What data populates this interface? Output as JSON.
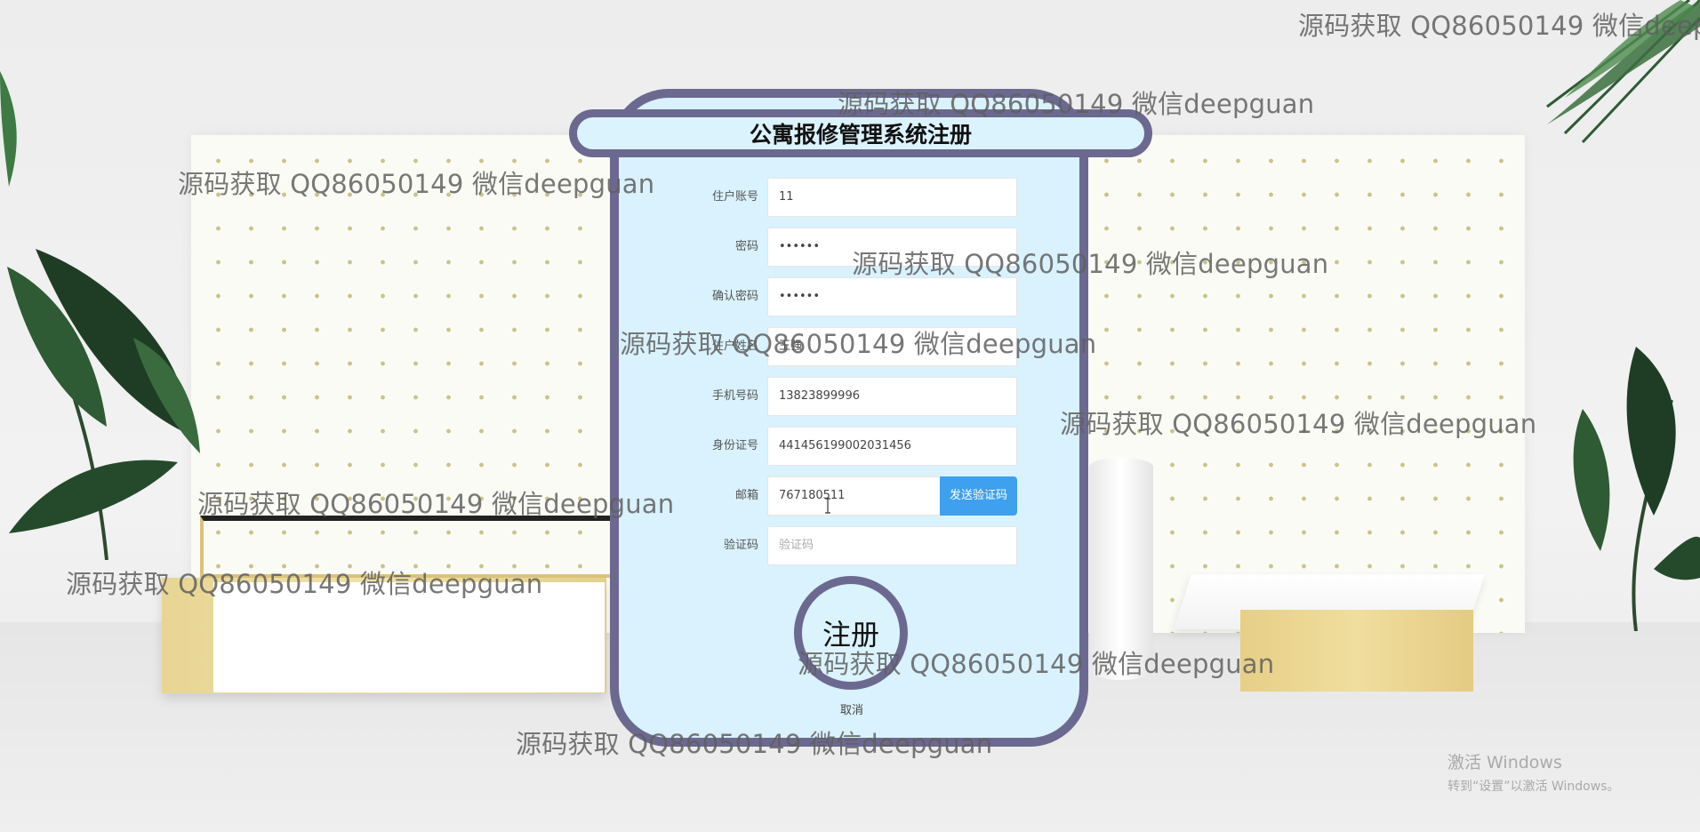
{
  "form": {
    "title": "公寓报修管理系统注册",
    "fields": [
      {
        "label": "住户账号",
        "value": "11"
      },
      {
        "label": "密码",
        "value": "••••••"
      },
      {
        "label": "确认密码",
        "value": "••••••"
      },
      {
        "label": "住户姓名",
        "value": "王强"
      },
      {
        "label": "手机号码",
        "value": "13823899996"
      },
      {
        "label": "身份证号",
        "value": "441456199002031456"
      },
      {
        "label": "邮箱",
        "value": "767180511"
      },
      {
        "label": "验证码",
        "placeholder": "验证码"
      }
    ],
    "send_code_label": "发送验证码",
    "register_label": "注册",
    "cancel_label": "取消"
  },
  "watermark_text": "源码获取 QQ86050149 微信deepguan",
  "os_overlay": {
    "line1": "激活 Windows",
    "line2": "转到“设置”以激活 Windows。"
  },
  "colors": {
    "card_bg": "#d9f2fd",
    "card_border": "#6c6990",
    "send_button": "#3ea0ee"
  }
}
